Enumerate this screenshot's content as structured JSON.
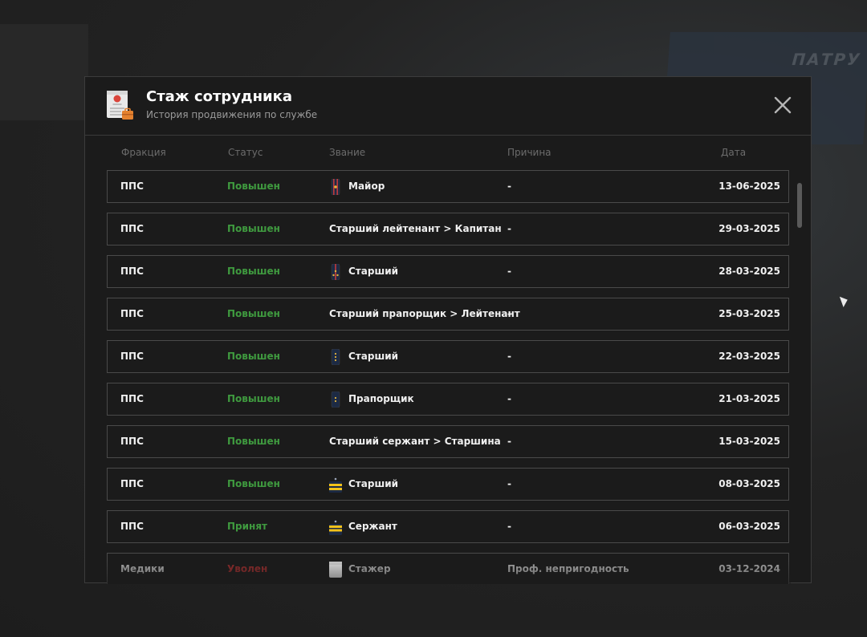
{
  "background": {
    "banner_text": "ПАТРУ"
  },
  "modal": {
    "title": "Стаж сотрудника",
    "subtitle": "История продвижения по службе",
    "icons": {
      "header": "personnel-document-icon",
      "close": "close-icon"
    }
  },
  "table": {
    "columns": {
      "faction": "Фракция",
      "status": "Статус",
      "rank": "Звание",
      "reason": "Причина",
      "date": "Дата"
    },
    "rows": [
      {
        "faction": "ППС",
        "status": "Повышен",
        "rank": "Майор",
        "rank_icon": "major-epaulette-icon",
        "reason": "-",
        "date": "13-06-2025"
      },
      {
        "faction": "ППС",
        "status": "Повышен",
        "rank": "Старший лейтенант > Капитан",
        "rank_icon": "",
        "reason": "-",
        "date": "29-03-2025"
      },
      {
        "faction": "ППС",
        "status": "Повышен",
        "rank": "Старший",
        "rank_icon": "senior-lieutenant-epaulette-icon",
        "reason": "-",
        "date": "28-03-2025"
      },
      {
        "faction": "ППС",
        "status": "Повышен",
        "rank": "Старший прапорщик > Лейтенант",
        "rank_icon": "",
        "reason": "-",
        "date": "25-03-2025"
      },
      {
        "faction": "ППС",
        "status": "Повышен",
        "rank": "Старший",
        "rank_icon": "senior-warrant-officer-epaulette-icon",
        "reason": "-",
        "date": "22-03-2025"
      },
      {
        "faction": "ППС",
        "status": "Повышен",
        "rank": "Прапорщик",
        "rank_icon": "warrant-officer-epaulette-icon",
        "reason": "-",
        "date": "21-03-2025"
      },
      {
        "faction": "ППС",
        "status": "Повышен",
        "rank": "Старший сержант > Старшина",
        "rank_icon": "",
        "reason": "-",
        "date": "15-03-2025"
      },
      {
        "faction": "ППС",
        "status": "Повышен",
        "rank": "Старший",
        "rank_icon": "senior-sergeant-epaulette-icon",
        "reason": "-",
        "date": "08-03-2025"
      },
      {
        "faction": "ППС",
        "status": "Принят",
        "rank": "Сержант",
        "rank_icon": "sergeant-epaulette-icon",
        "reason": "-",
        "date": "06-03-2025"
      },
      {
        "faction": "Медики",
        "status": "Уволен",
        "rank": "Стажер",
        "rank_icon": "intern-badge-icon",
        "reason": "Проф. непригодность",
        "date": "03-12-2024"
      }
    ]
  },
  "colors": {
    "promoted": "#3f9a3f",
    "fired": "#8c2b2b",
    "modal_bg": "#1b1b1b",
    "row_border": "#4a4a4a"
  }
}
